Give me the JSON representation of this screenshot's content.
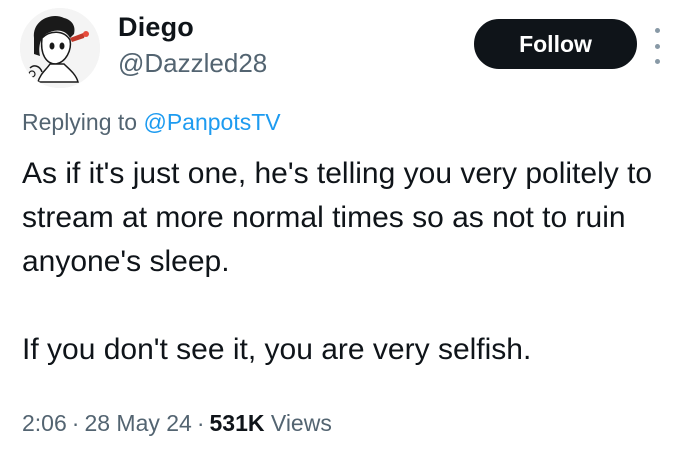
{
  "author": {
    "display_name": "Diego",
    "handle": "@Dazzled28"
  },
  "follow_button": {
    "label": "Follow"
  },
  "reply_context": {
    "prefix": "Replying to",
    "mention": "@PanpotsTV"
  },
  "tweet": {
    "paragraphs": [
      "As if it's just one, he's telling you very politely to stream at more normal times so as not to ruin anyone's sleep.",
      "If you don't see it, you are very selfish."
    ]
  },
  "meta": {
    "time": "2:06",
    "separator": "·",
    "date": "28 May 24",
    "views_count": "531K",
    "views_label": "Views"
  },
  "icons": {
    "avatar": "avatar-illustration",
    "more": "more-options-icon"
  },
  "colors": {
    "text": "#0f1419",
    "secondary": "#536471",
    "link": "#1d9bf0",
    "button_bg": "#0f1419",
    "button_text": "#ffffff"
  }
}
